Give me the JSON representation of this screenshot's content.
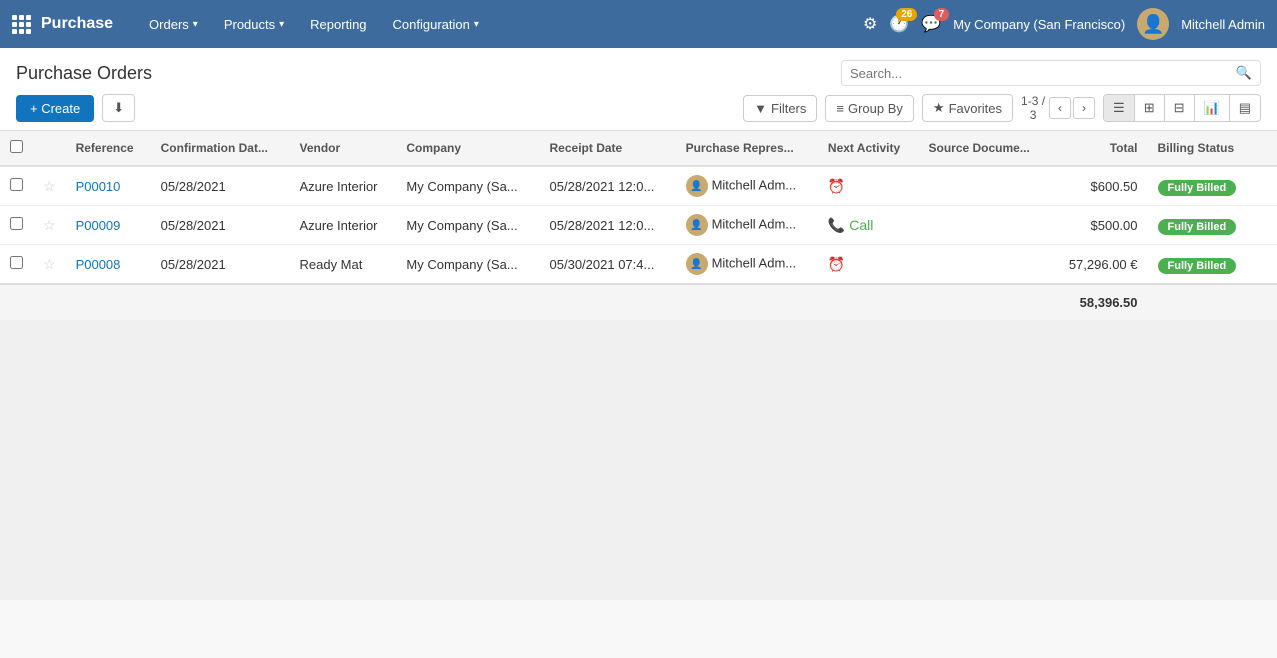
{
  "nav": {
    "app_title": "Purchase",
    "menu_items": [
      {
        "label": "Orders",
        "has_caret": true
      },
      {
        "label": "Products",
        "has_caret": true
      },
      {
        "label": "Reporting",
        "has_caret": false
      },
      {
        "label": "Configuration",
        "has_caret": true
      }
    ],
    "icons": {
      "settings": "⚙",
      "activity_count": "26",
      "message_count": "7"
    },
    "company": "My Company (San Francisco)",
    "user_name": "Mitchell Admin"
  },
  "page": {
    "title": "Purchase Orders",
    "search_placeholder": "Search...",
    "create_label": "+ Create",
    "download_label": "⬇",
    "filters_label": "Filters",
    "groupby_label": "Group By",
    "favorites_label": "Favorites",
    "pagination": "1-3 /\n3"
  },
  "columns": [
    "Reference",
    "Confirmation Dat...",
    "Vendor",
    "Company",
    "Receipt Date",
    "Purchase Repres...",
    "Next Activity",
    "Source Docume...",
    "Total",
    "Billing Status"
  ],
  "rows": [
    {
      "id": "P00010",
      "confirmation_date": "05/28/2021",
      "vendor": "Azure Interior",
      "company": "My Company (Sa...",
      "receipt_date": "05/28/2021 12:0...",
      "rep": "Mitchell Adm...",
      "next_activity": "",
      "source_doc": "",
      "total": "$600.50",
      "billing_status": "Fully Billed"
    },
    {
      "id": "P00009",
      "confirmation_date": "05/28/2021",
      "vendor": "Azure Interior",
      "company": "My Company (Sa...",
      "receipt_date": "05/28/2021 12:0...",
      "rep": "Mitchell Adm...",
      "next_activity": "Call",
      "source_doc": "",
      "total": "$500.00",
      "billing_status": "Fully Billed"
    },
    {
      "id": "P00008",
      "confirmation_date": "05/28/2021",
      "vendor": "Ready Mat",
      "company": "My Company (Sa...",
      "receipt_date": "05/30/2021 07:4...",
      "rep": "Mitchell Adm...",
      "next_activity": "",
      "source_doc": "",
      "total": "57,296.00 €",
      "billing_status": "Fully Billed"
    }
  ],
  "footer": {
    "total": "58,396.50"
  }
}
